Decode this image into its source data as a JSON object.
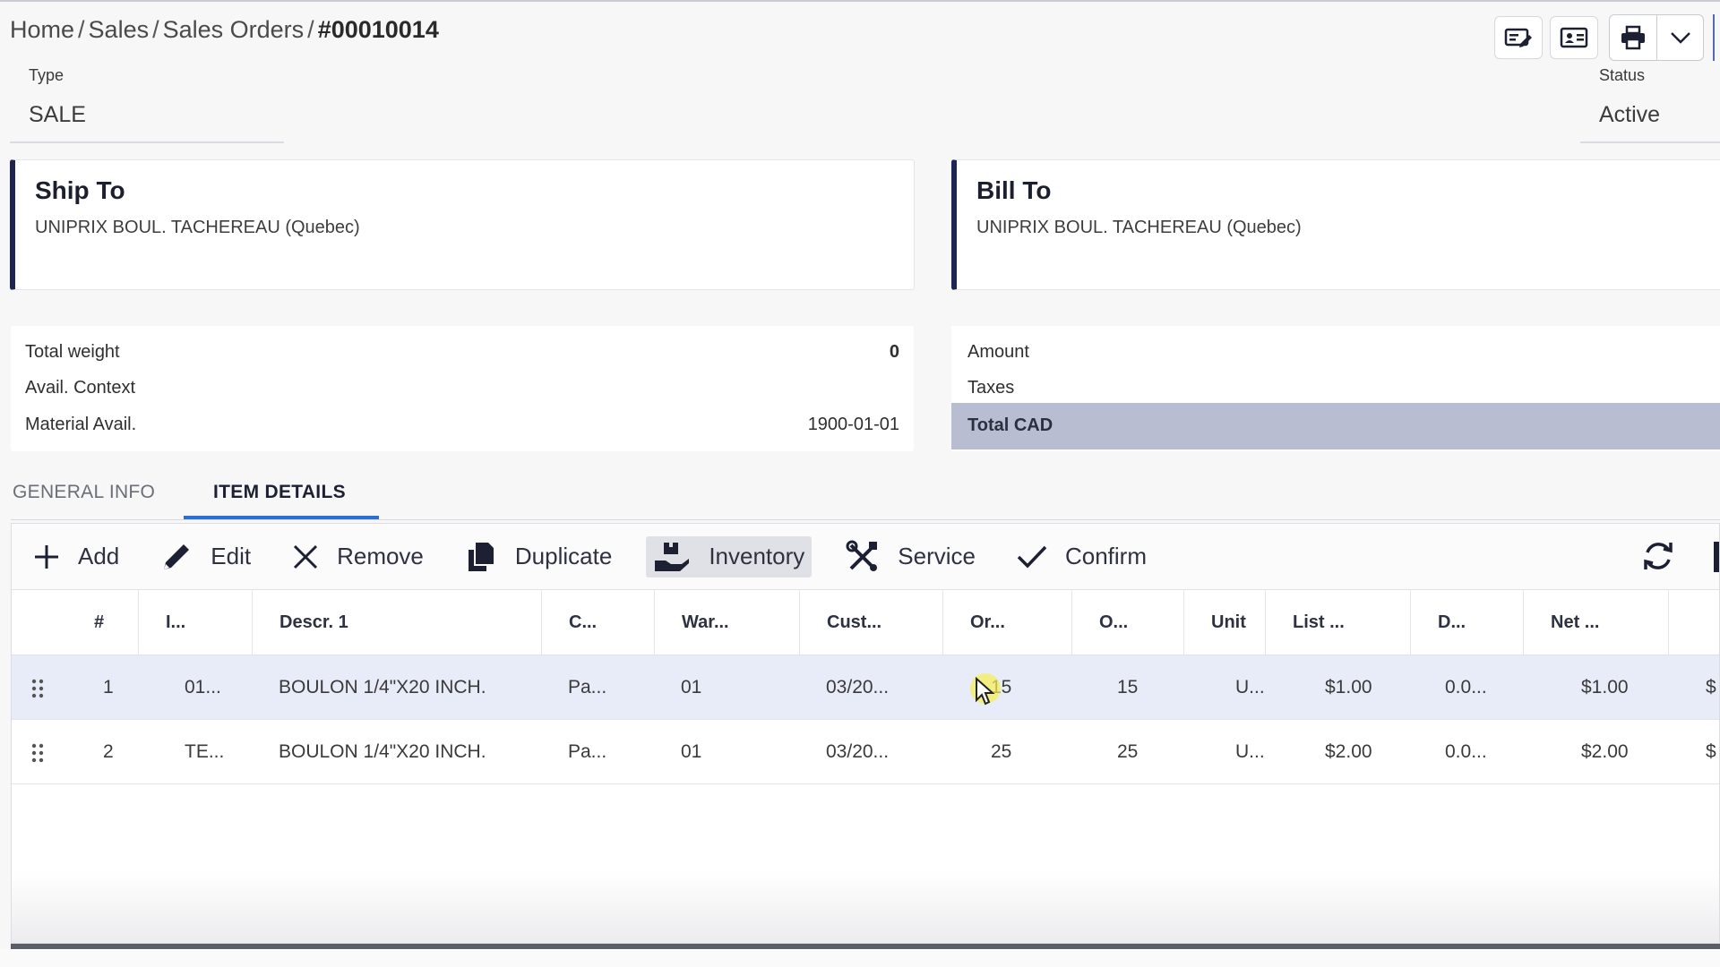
{
  "breadcrumb": {
    "items": [
      "Home",
      "Sales",
      "Sales Orders"
    ],
    "current": "#00010014",
    "separator": "/"
  },
  "top_actions": {
    "icons": [
      "edit-card-icon",
      "contact-card-icon",
      "printer-icon",
      "chevron-down-icon"
    ]
  },
  "header": {
    "type_label": "Type",
    "type_value": "SALE",
    "status_label": "Status",
    "status_value": "Active"
  },
  "ship_to": {
    "title": "Ship To",
    "address": "UNIPRIX BOUL. TACHEREAU (Quebec)"
  },
  "bill_to": {
    "title": "Bill To",
    "address": "UNIPRIX BOUL. TACHEREAU (Quebec)"
  },
  "summary_left": {
    "total_weight_label": "Total weight",
    "total_weight_value": "0",
    "avail_context_label": "Avail. Context",
    "material_avail_label": "Material Avail.",
    "material_avail_value": "1900-01-01"
  },
  "summary_right": {
    "amount_label": "Amount",
    "taxes_label": "Taxes",
    "total_label": "Total CAD"
  },
  "tabs": [
    {
      "label": "GENERAL INFO",
      "active": false
    },
    {
      "label": "ITEM DETAILS",
      "active": true
    }
  ],
  "toolbar": {
    "add_label": "Add",
    "edit_label": "Edit",
    "remove_label": "Remove",
    "duplicate_label": "Duplicate",
    "inventory_label": "Inventory",
    "service_label": "Service",
    "confirm_label": "Confirm"
  },
  "grid": {
    "columns": [
      "#",
      "I...",
      "Descr. 1",
      "C...",
      "War...",
      "Cust...",
      "Or...",
      "O...",
      "Unit",
      "List ...",
      "D...",
      "Net ..."
    ],
    "rows": [
      {
        "num": "1",
        "item": "01...",
        "descr": "BOULON 1/4\"X20 INCH.",
        "c": "Pa...",
        "war": "01",
        "cust": "03/20...",
        "or": "15",
        "o": "15",
        "unit": "U...",
        "list": "$1.00",
        "d": "0.0...",
        "net": "$1.00",
        "extra": "$",
        "selected": true
      },
      {
        "num": "2",
        "item": "TE...",
        "descr": "BOULON 1/4\"X20 INCH.",
        "c": "Pa...",
        "war": "01",
        "cust": "03/20...",
        "or": "25",
        "o": "25",
        "unit": "U...",
        "list": "$2.00",
        "d": "0.0...",
        "net": "$2.00",
        "extra": "$",
        "selected": false
      }
    ]
  },
  "colors": {
    "accent_navy": "#1e2550",
    "tab_underline": "#2b6fd1",
    "total_band": "#b9bdd2",
    "selected_row": "#e7ecf8"
  }
}
